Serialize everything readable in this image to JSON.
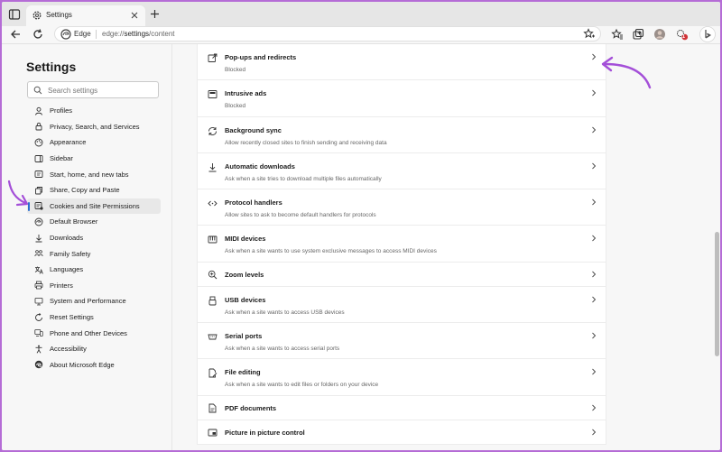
{
  "browser": {
    "tab_title": "Settings",
    "address_site": "Edge",
    "address_url_pre": "edge://",
    "address_url_bold": "settings",
    "address_url_post": "/content",
    "notification_count": "1"
  },
  "sidebar": {
    "title": "Settings",
    "search_placeholder": "Search settings",
    "items": [
      {
        "label": "Profiles",
        "icon": "profile-icon"
      },
      {
        "label": "Privacy, Search, and Services",
        "icon": "lock-icon"
      },
      {
        "label": "Appearance",
        "icon": "appearance-icon"
      },
      {
        "label": "Sidebar",
        "icon": "sidebar-icon"
      },
      {
        "label": "Start, home, and new tabs",
        "icon": "home-icon"
      },
      {
        "label": "Share, Copy and Paste",
        "icon": "share-icon"
      },
      {
        "label": "Cookies and Site Permissions",
        "icon": "cookie-icon"
      },
      {
        "label": "Default Browser",
        "icon": "browser-icon"
      },
      {
        "label": "Downloads",
        "icon": "download-icon"
      },
      {
        "label": "Family Safety",
        "icon": "family-icon"
      },
      {
        "label": "Languages",
        "icon": "language-icon"
      },
      {
        "label": "Printers",
        "icon": "printer-icon"
      },
      {
        "label": "System and Performance",
        "icon": "system-icon"
      },
      {
        "label": "Reset Settings",
        "icon": "reset-icon"
      },
      {
        "label": "Phone and Other Devices",
        "icon": "phone-icon"
      },
      {
        "label": "Accessibility",
        "icon": "accessibility-icon"
      },
      {
        "label": "About Microsoft Edge",
        "icon": "edge-icon"
      }
    ]
  },
  "content": {
    "rows": [
      {
        "title": "Pop-ups and redirects",
        "desc": "Blocked"
      },
      {
        "title": "Intrusive ads",
        "desc": "Blocked"
      },
      {
        "title": "Background sync",
        "desc": "Allow recently closed sites to finish sending and receiving data"
      },
      {
        "title": "Automatic downloads",
        "desc": "Ask when a site tries to download multiple files automatically"
      },
      {
        "title": "Protocol handlers",
        "desc": "Allow sites to ask to become default handlers for protocols"
      },
      {
        "title": "MIDI devices",
        "desc": "Ask when a site wants to use system exclusive messages to access MIDI devices"
      },
      {
        "title": "Zoom levels",
        "desc": ""
      },
      {
        "title": "USB devices",
        "desc": "Ask when a site wants to access USB devices"
      },
      {
        "title": "Serial ports",
        "desc": "Ask when a site wants to access serial ports"
      },
      {
        "title": "File editing",
        "desc": "Ask when a site wants to edit files or folders on your device"
      },
      {
        "title": "PDF documents",
        "desc": ""
      },
      {
        "title": "Picture in picture control",
        "desc": ""
      }
    ]
  },
  "colors": {
    "accent": "#2a6fd1",
    "annotation": "#a44fd8",
    "frame": "#b56cd6"
  }
}
